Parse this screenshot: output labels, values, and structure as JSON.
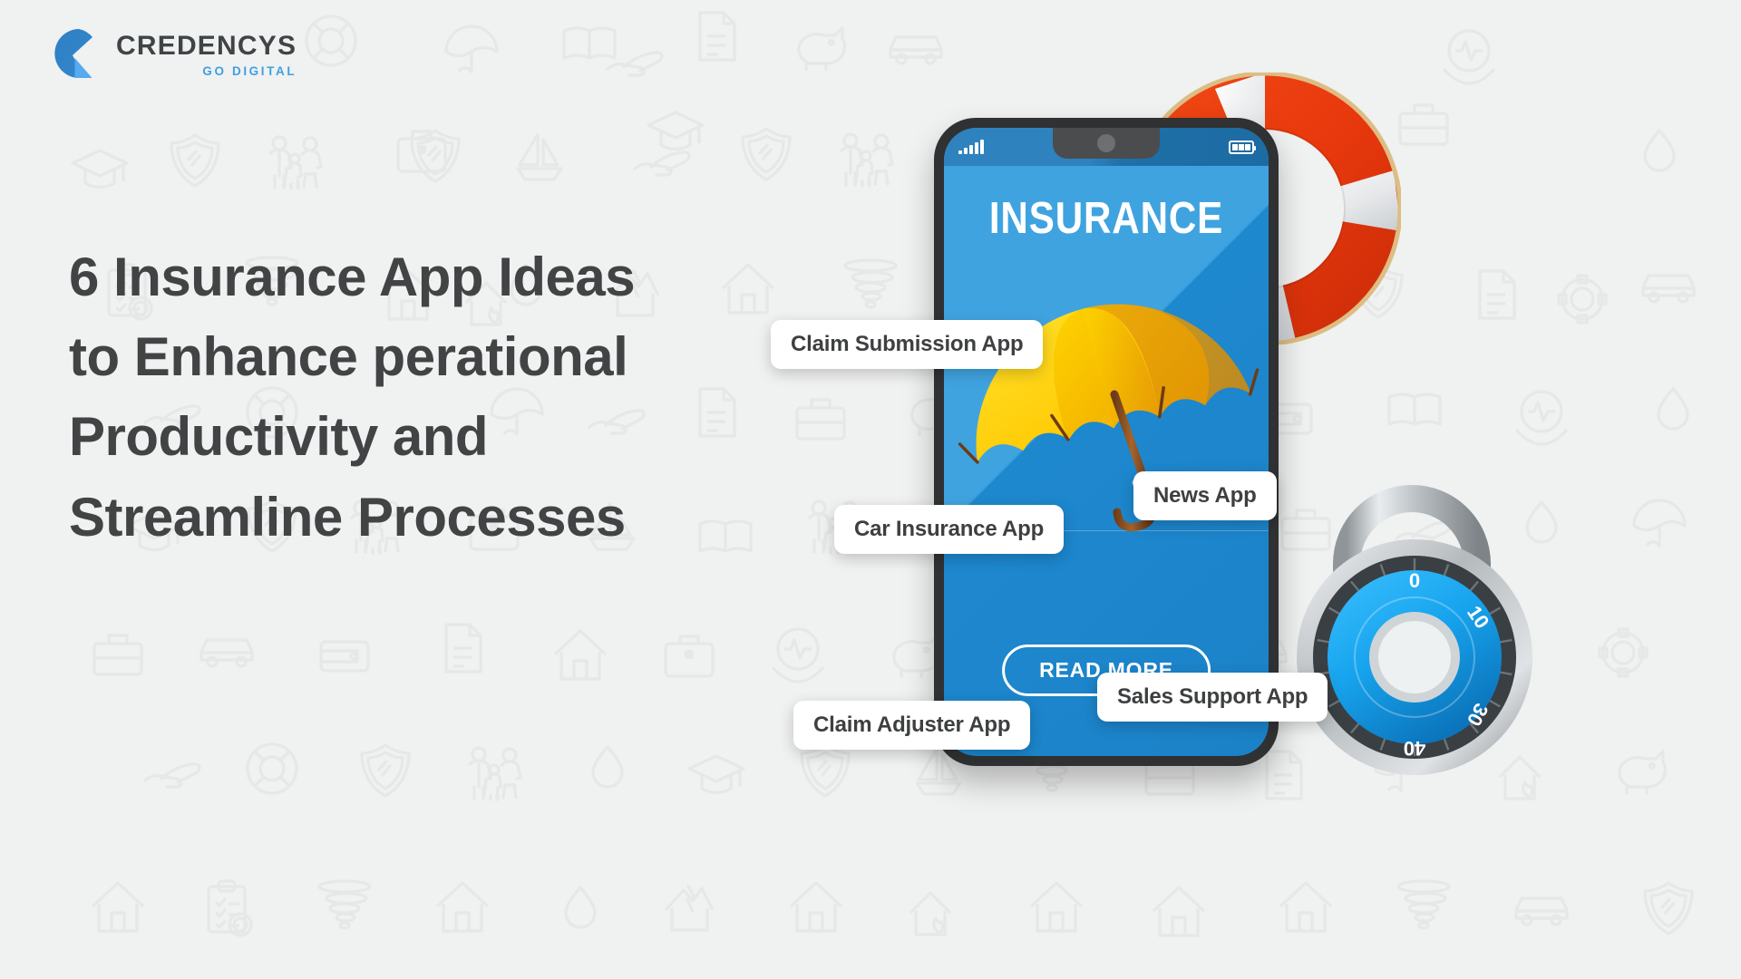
{
  "brand": {
    "logo_icon": "credencys-circle-mark",
    "name": "CREDENCYS",
    "tagline": "GO DIGITAL",
    "name_color": "#3f4447",
    "tagline_color": "#3ea0e0"
  },
  "headline": {
    "lines": [
      "6 Insurance App Ideas",
      "to Enhance perational",
      "Productivity and",
      "Streamline Processes"
    ],
    "color": "#414345"
  },
  "phone": {
    "status_bar": {
      "signal_icon": "signal-bars-icon",
      "signal_bars": 5,
      "battery_icon": "battery-icon",
      "battery_segments": 3,
      "camera_icon": "front-camera-icon"
    },
    "screen_title": "INSURANCE",
    "hero_icon": "yellow-umbrella",
    "cta_label": "READ MORE",
    "screen_color": "#3fa3e0",
    "frame_color": "#2f3133"
  },
  "badges": [
    {
      "label": "Claim Submission App"
    },
    {
      "label": "Car Insurance App"
    },
    {
      "label": "News App"
    },
    {
      "label": "Sales Support App"
    },
    {
      "label": "Claim Adjuster App"
    }
  ],
  "decorations": {
    "lifering": {
      "icon": "life-ring",
      "ring_color": "#e8380d",
      "band_color": "#ffffff",
      "rope_color": "#e3c78d"
    },
    "padlock": {
      "icon": "combination-padlock",
      "dial_color": "#24a6ef",
      "shackle_color": "#c8ccce",
      "dial_numbers": [
        "0",
        "10",
        "30",
        "40"
      ]
    }
  },
  "background": {
    "color": "#f0f1f1",
    "pattern_icon_names": [
      "shield-icon",
      "family-icon",
      "tornado-icon",
      "clipboard-check-icon",
      "house-icon",
      "graduation-cap-icon",
      "life-ring-icon",
      "umbrella-icon",
      "car-icon",
      "sailboat-icon",
      "first-aid-kit-icon",
      "piggy-bank-icon",
      "handshake-icon",
      "heart-pulse-icon",
      "suitcase-icon",
      "water-drop-icon",
      "fire-house-icon",
      "broken-house-icon",
      "hand-care-icon",
      "wallet-icon",
      "document-icon",
      "book-icon",
      "gear-icon",
      "key-icon"
    ],
    "pattern_color": "#e6e7e7"
  }
}
